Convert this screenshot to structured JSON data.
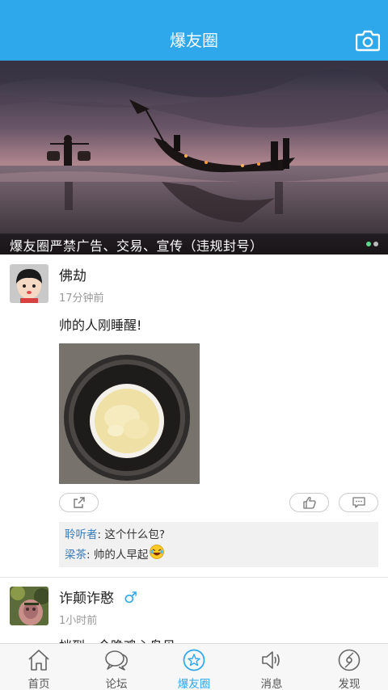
{
  "header": {
    "title": "爆友圈",
    "camera_icon": "camera-icon"
  },
  "banner": {
    "caption": "爆友圈严禁广告、交易、宣传（违规封号）",
    "dots": 2,
    "active_dot": 0
  },
  "posts": [
    {
      "username": "佛劫",
      "time": "17分钟前",
      "text": "帅的人刚睡醒!",
      "comments": [
        {
          "name": "聆听者",
          "sep": ": ",
          "text": "这个什么包?"
        },
        {
          "name": "梁茶",
          "sep": ": ",
          "text": "帅的人早起",
          "emoji": "laughing-crying-emoji"
        }
      ]
    },
    {
      "username": "诈颠诈憨",
      "gender_symbol": "♂",
      "time": "1小时前",
      "text": "挡到，今晚鸡心鸟贝"
    }
  ],
  "tabs": [
    {
      "label": "首页",
      "icon": "home-icon"
    },
    {
      "label": "论坛",
      "icon": "chat-bubbles-icon"
    },
    {
      "label": "爆友圈",
      "icon": "star-circle-icon"
    },
    {
      "label": "消息",
      "icon": "speaker-icon"
    },
    {
      "label": "发现",
      "icon": "disc-icon"
    }
  ],
  "active_tab": 2,
  "colors": {
    "brand": "#2ea7eb",
    "comment_name": "#3a7cb6",
    "muted": "#999999"
  }
}
